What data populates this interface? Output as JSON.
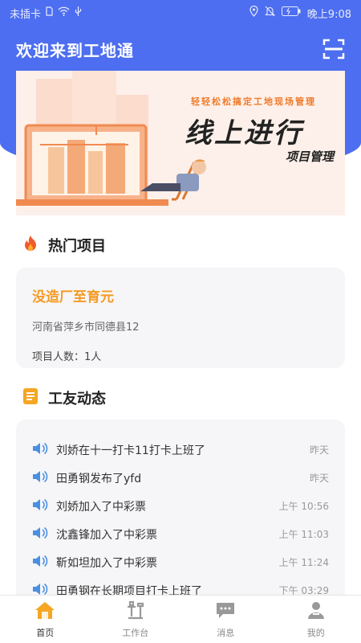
{
  "status_bar": {
    "carrier": "未插卡",
    "time": "晚上9:08"
  },
  "header": {
    "title": "欢迎来到工地通"
  },
  "banner": {
    "slogan": "轻轻松松搞定工地现场管理",
    "title": "线上进行",
    "subtitle": "项目管理"
  },
  "hot_projects": {
    "title": "热门项目",
    "card": {
      "name": "没造厂至育元",
      "address": "河南省萍乡市同德县12",
      "members": "项目人数：1人"
    }
  },
  "worker_feed": {
    "title": "工友动态",
    "items": [
      {
        "text": "刘娇在十一打卡11打卡上班了",
        "time": "昨天"
      },
      {
        "text": "田勇钢发布了yfd",
        "time": "昨天"
      },
      {
        "text": "刘娇加入了中彩票",
        "time": "上午 10:56"
      },
      {
        "text": "沈鑫锋加入了中彩票",
        "time": "上午 11:03"
      },
      {
        "text": "靳如坦加入了中彩票",
        "time": "上午 11:24"
      },
      {
        "text": "田勇钢在长期项目打卡上班了",
        "time": "下午 03:29"
      }
    ]
  },
  "tab_bar": {
    "tabs": [
      {
        "label": "首页",
        "icon": "home-icon",
        "active": true
      },
      {
        "label": "工作台",
        "icon": "workbench-icon",
        "active": false
      },
      {
        "label": "消息",
        "icon": "message-icon",
        "active": false
      },
      {
        "label": "我的",
        "icon": "profile-icon",
        "active": false
      }
    ]
  },
  "colors": {
    "primary": "#4d6ef0",
    "accent_orange": "#f59a23",
    "speaker_blue": "#4a90e2"
  }
}
